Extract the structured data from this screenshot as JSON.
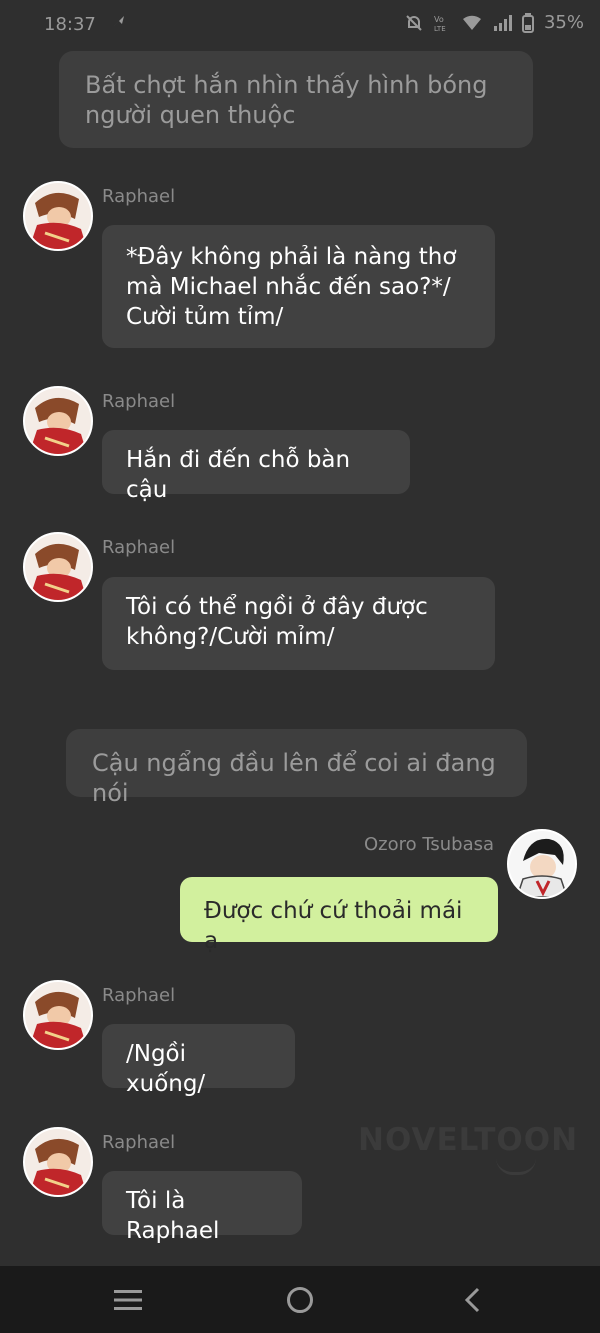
{
  "status_bar": {
    "time": "18:37",
    "battery": "35%",
    "icons": [
      "navigation-arrow-icon",
      "mute-icon",
      "volte-icon",
      "wifi-icon",
      "signal-icon",
      "battery-icon"
    ]
  },
  "narration": [
    {
      "text": "Bất chợt hắn nhìn thấy hình bóng người quen thuộc"
    },
    {
      "text": "Cậu ngẩng đầu lên để coi ai đang nói"
    }
  ],
  "messages": [
    {
      "sender": "Raphael",
      "text": "*Đây không phải là nàng thơ mà Michael nhắc đến sao?*/ Cười tủm tỉm/"
    },
    {
      "sender": "Raphael",
      "text": "Hắn đi đến chỗ bàn cậu"
    },
    {
      "sender": "Raphael",
      "text": "Tôi có thể ngồi ở đây được không?/Cười mỉm/"
    },
    {
      "sender": "Ozoro Tsubasa",
      "text": "Được chứ cứ thoải mái ạ"
    },
    {
      "sender": "Raphael",
      "text": "/Ngồi xuống/"
    },
    {
      "sender": "Raphael",
      "text": "Tôi là Raphael"
    }
  ],
  "watermark": "NOVELTOON",
  "nav_bar": {
    "icons": [
      "menu-icon",
      "home-icon",
      "back-icon"
    ]
  },
  "colors": {
    "background": "#2f2f2f",
    "bubble": "#414141",
    "my_bubble": "#d2f09e",
    "narration": "#3e3e3e"
  }
}
